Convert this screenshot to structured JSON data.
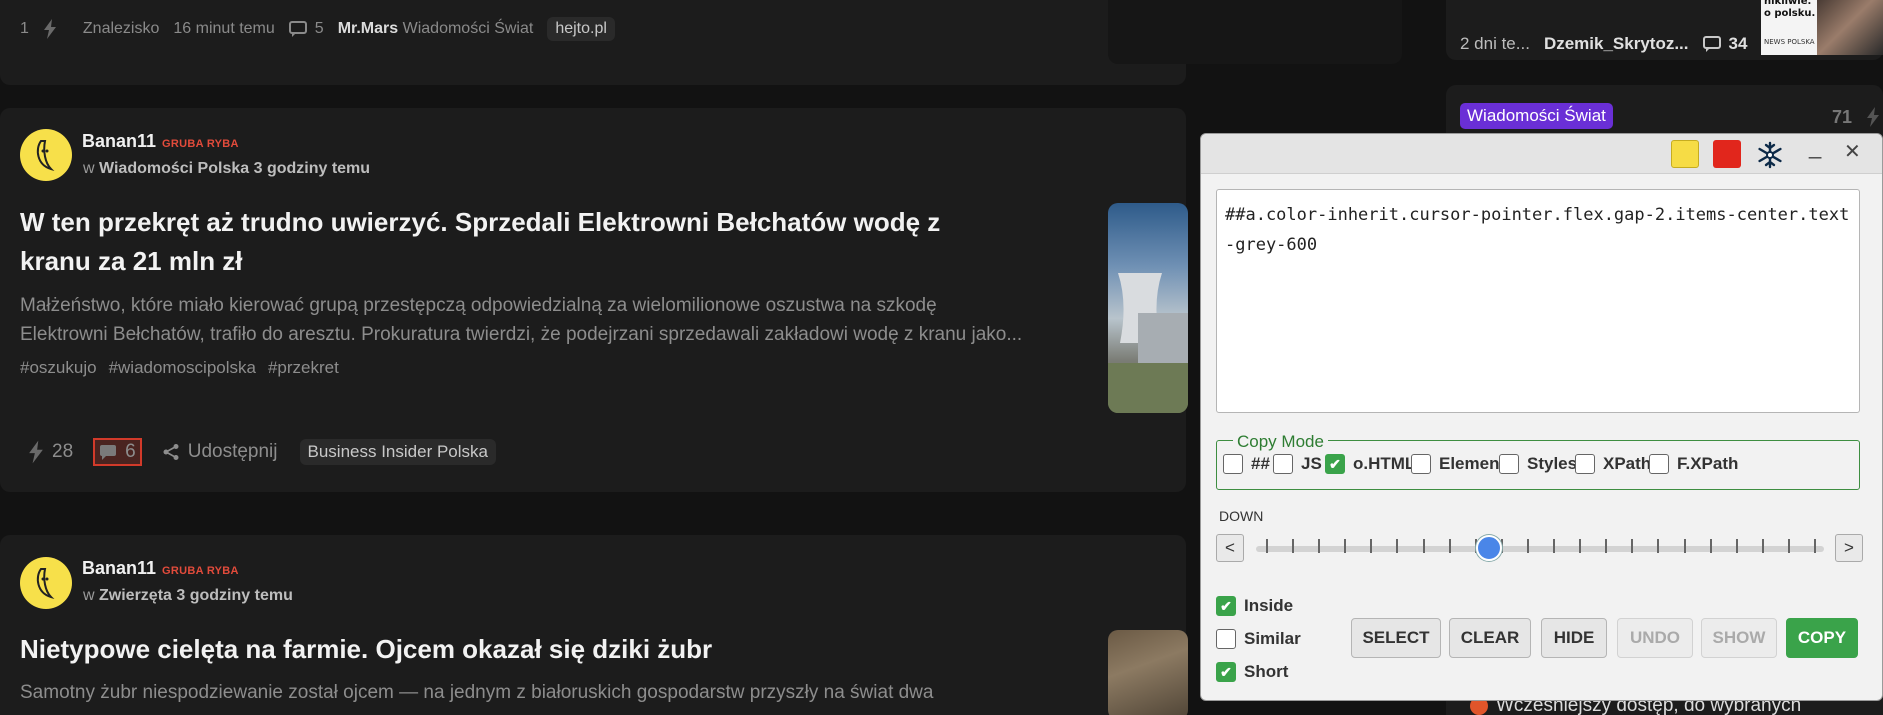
{
  "top_card": {
    "votes": "1",
    "section": "Znalezisko",
    "time": "16 minut temu",
    "comments": "5",
    "author": "Mr.Mars",
    "category": "Wiadomości Świat",
    "source": "hejto.pl"
  },
  "posts": [
    {
      "username": "Banan11",
      "rank": "GRUBA RYBA",
      "in_prefix": "w",
      "community": "Wiadomości Polska",
      "time": "3 godziny temu",
      "title_line1": "W ten przekręt aż trudno uwierzyć. Sprzedali Elektrowni Bełchatów wodę z",
      "title_line2": "kranu za 21 mln zł",
      "excerpt_line1": "Małżeństwo, które miało kierować grupą przestępczą odpowiedzialną za wielomilionowe oszustwa na szkodę",
      "excerpt_line2": "Elektrowni Bełchatów, trafiło do aresztu. Prokuratura twierdzi, że podejrzani sprzedawali zakładowi wodę z kranu jako...",
      "tags": [
        "#oszukujo",
        "#wiadomoscipolska",
        "#przekret"
      ],
      "votes": "28",
      "comments": "6",
      "share": "Udostępnij",
      "source": "Business Insider Polska"
    },
    {
      "username": "Banan11",
      "rank": "GRUBA RYBA",
      "in_prefix": "w",
      "community": "Zwierzęta",
      "time": "3 godziny temu",
      "title_line1": "Nietypowe cielęta na farmie. Ojcem okazał się dziki żubr",
      "excerpt_line1": "Samotny żubr niespodziewanie został ojcem — na jednym z białoruskich gospodarstw przyszły na świat dwa"
    }
  ],
  "sidebar": {
    "item1": {
      "time": "2 dni te...",
      "author": "Dzemik_Skrytoz...",
      "comments": "34",
      "thumb_text_1": "nikliwie.",
      "thumb_text_2": "o polsku.",
      "thumb_text_3": "NEWS POLSKA"
    },
    "item2": {
      "category": "Wiadomości Świat",
      "votes": "71"
    },
    "bottom_text": "Wcześniejszy dostęp, do wybranych"
  },
  "panel": {
    "colors": {
      "yellow": "#f6dc45",
      "red": "#e1261c"
    },
    "selector": "##a.color-inherit.cursor-pointer.flex.gap-2.items-center.text-grey-600",
    "copy_mode_label": "Copy Mode",
    "modes": [
      {
        "label": "##",
        "checked": false
      },
      {
        "label": "JS",
        "checked": false
      },
      {
        "label": "o.HTML",
        "checked": true
      },
      {
        "label": "Element",
        "checked": false
      },
      {
        "label": "Styles",
        "checked": false
      },
      {
        "label": "XPath",
        "checked": false
      },
      {
        "label": "F.XPath",
        "checked": false
      }
    ],
    "direction_label": "DOWN",
    "prev": "<",
    "next": ">",
    "slider_position": 0.41,
    "options": [
      {
        "label": "Inside",
        "checked": true
      },
      {
        "label": "Similar",
        "checked": false
      },
      {
        "label": "Short",
        "checked": true
      }
    ],
    "buttons": {
      "select": "SELECT",
      "clear": "CLEAR",
      "hide": "HIDE",
      "undo": "UNDO",
      "show": "SHOW",
      "copy": "COPY"
    },
    "minimize": "_",
    "close": "✕"
  }
}
